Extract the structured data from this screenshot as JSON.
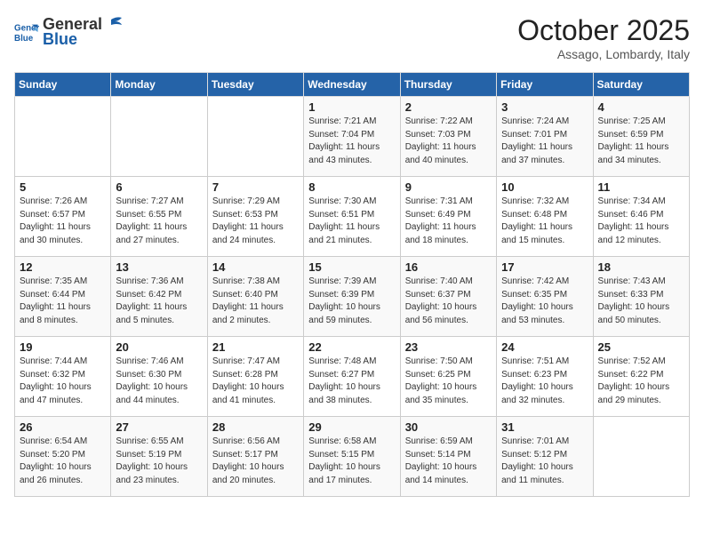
{
  "header": {
    "logo_line1": "General",
    "logo_line2": "Blue",
    "month": "October 2025",
    "location": "Assago, Lombardy, Italy"
  },
  "weekdays": [
    "Sunday",
    "Monday",
    "Tuesday",
    "Wednesday",
    "Thursday",
    "Friday",
    "Saturday"
  ],
  "weeks": [
    [
      {
        "day": "",
        "text": ""
      },
      {
        "day": "",
        "text": ""
      },
      {
        "day": "",
        "text": ""
      },
      {
        "day": "1",
        "text": "Sunrise: 7:21 AM\nSunset: 7:04 PM\nDaylight: 11 hours\nand 43 minutes."
      },
      {
        "day": "2",
        "text": "Sunrise: 7:22 AM\nSunset: 7:03 PM\nDaylight: 11 hours\nand 40 minutes."
      },
      {
        "day": "3",
        "text": "Sunrise: 7:24 AM\nSunset: 7:01 PM\nDaylight: 11 hours\nand 37 minutes."
      },
      {
        "day": "4",
        "text": "Sunrise: 7:25 AM\nSunset: 6:59 PM\nDaylight: 11 hours\nand 34 minutes."
      }
    ],
    [
      {
        "day": "5",
        "text": "Sunrise: 7:26 AM\nSunset: 6:57 PM\nDaylight: 11 hours\nand 30 minutes."
      },
      {
        "day": "6",
        "text": "Sunrise: 7:27 AM\nSunset: 6:55 PM\nDaylight: 11 hours\nand 27 minutes."
      },
      {
        "day": "7",
        "text": "Sunrise: 7:29 AM\nSunset: 6:53 PM\nDaylight: 11 hours\nand 24 minutes."
      },
      {
        "day": "8",
        "text": "Sunrise: 7:30 AM\nSunset: 6:51 PM\nDaylight: 11 hours\nand 21 minutes."
      },
      {
        "day": "9",
        "text": "Sunrise: 7:31 AM\nSunset: 6:49 PM\nDaylight: 11 hours\nand 18 minutes."
      },
      {
        "day": "10",
        "text": "Sunrise: 7:32 AM\nSunset: 6:48 PM\nDaylight: 11 hours\nand 15 minutes."
      },
      {
        "day": "11",
        "text": "Sunrise: 7:34 AM\nSunset: 6:46 PM\nDaylight: 11 hours\nand 12 minutes."
      }
    ],
    [
      {
        "day": "12",
        "text": "Sunrise: 7:35 AM\nSunset: 6:44 PM\nDaylight: 11 hours\nand 8 minutes."
      },
      {
        "day": "13",
        "text": "Sunrise: 7:36 AM\nSunset: 6:42 PM\nDaylight: 11 hours\nand 5 minutes."
      },
      {
        "day": "14",
        "text": "Sunrise: 7:38 AM\nSunset: 6:40 PM\nDaylight: 11 hours\nand 2 minutes."
      },
      {
        "day": "15",
        "text": "Sunrise: 7:39 AM\nSunset: 6:39 PM\nDaylight: 10 hours\nand 59 minutes."
      },
      {
        "day": "16",
        "text": "Sunrise: 7:40 AM\nSunset: 6:37 PM\nDaylight: 10 hours\nand 56 minutes."
      },
      {
        "day": "17",
        "text": "Sunrise: 7:42 AM\nSunset: 6:35 PM\nDaylight: 10 hours\nand 53 minutes."
      },
      {
        "day": "18",
        "text": "Sunrise: 7:43 AM\nSunset: 6:33 PM\nDaylight: 10 hours\nand 50 minutes."
      }
    ],
    [
      {
        "day": "19",
        "text": "Sunrise: 7:44 AM\nSunset: 6:32 PM\nDaylight: 10 hours\nand 47 minutes."
      },
      {
        "day": "20",
        "text": "Sunrise: 7:46 AM\nSunset: 6:30 PM\nDaylight: 10 hours\nand 44 minutes."
      },
      {
        "day": "21",
        "text": "Sunrise: 7:47 AM\nSunset: 6:28 PM\nDaylight: 10 hours\nand 41 minutes."
      },
      {
        "day": "22",
        "text": "Sunrise: 7:48 AM\nSunset: 6:27 PM\nDaylight: 10 hours\nand 38 minutes."
      },
      {
        "day": "23",
        "text": "Sunrise: 7:50 AM\nSunset: 6:25 PM\nDaylight: 10 hours\nand 35 minutes."
      },
      {
        "day": "24",
        "text": "Sunrise: 7:51 AM\nSunset: 6:23 PM\nDaylight: 10 hours\nand 32 minutes."
      },
      {
        "day": "25",
        "text": "Sunrise: 7:52 AM\nSunset: 6:22 PM\nDaylight: 10 hours\nand 29 minutes."
      }
    ],
    [
      {
        "day": "26",
        "text": "Sunrise: 6:54 AM\nSunset: 5:20 PM\nDaylight: 10 hours\nand 26 minutes."
      },
      {
        "day": "27",
        "text": "Sunrise: 6:55 AM\nSunset: 5:19 PM\nDaylight: 10 hours\nand 23 minutes."
      },
      {
        "day": "28",
        "text": "Sunrise: 6:56 AM\nSunset: 5:17 PM\nDaylight: 10 hours\nand 20 minutes."
      },
      {
        "day": "29",
        "text": "Sunrise: 6:58 AM\nSunset: 5:15 PM\nDaylight: 10 hours\nand 17 minutes."
      },
      {
        "day": "30",
        "text": "Sunrise: 6:59 AM\nSunset: 5:14 PM\nDaylight: 10 hours\nand 14 minutes."
      },
      {
        "day": "31",
        "text": "Sunrise: 7:01 AM\nSunset: 5:12 PM\nDaylight: 10 hours\nand 11 minutes."
      },
      {
        "day": "",
        "text": ""
      }
    ]
  ]
}
